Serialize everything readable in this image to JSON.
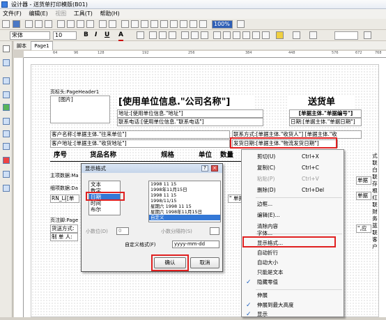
{
  "window": {
    "title": "设计器 - 送货单打印模版(B01)"
  },
  "menu": [
    "文件(F)",
    "编辑(E)",
    "视图",
    "工具(T)",
    "帮助(H)"
  ],
  "toolbar": {
    "zoom": "100%",
    "font_name": "宋体",
    "font_size": "10",
    "bold": "B",
    "italic": "I",
    "underline": "U",
    "font_color": "A"
  },
  "tabs": {
    "script": "脚本",
    "page": "Page1"
  },
  "ruler_marks": [
    "64",
    "96",
    "128",
    "192",
    "256",
    "384",
    "448",
    "576",
    "672",
    "768"
  ],
  "report": {
    "page_header_label": "页标头:PageHeader1",
    "picture": "[图片]",
    "company_title": "[使用单位信息.\"公司名称\"]",
    "doc_title": "送货单",
    "address": "地址:[使用单位信息.\"地址\"]",
    "doc_no": "[单据主体.\"单据编号\"]",
    "phone": "联系电话:[使用单位信息.\"联系电话\"]",
    "date": "日期:[单据主体.\"单据日期\"]",
    "customer": "客户名称:[单据主体.\"往来单位\"]",
    "contact": "联系方式:[单据主体.\"收货人\"] [单据主体.\"收",
    "cust_address": "客户地址:[单据主体.\"收货地址\"]",
    "ship_date": "发货日期:[单据主体.\"物流发货日期\"]",
    "col_no": "序号",
    "col_name": "货品名称",
    "col_spec": "规格",
    "col_unit": "单位",
    "col_qty": "数量",
    "main_band": "主项数据:Ma",
    "detail_band": "细项数据:Da",
    "detail_line": "RN_Lin",
    "detail_cell": "[单",
    "detail_cell2": "\" 单据",
    "footer_band": "页注脚:Page",
    "ship_method": "货送方式:",
    "maker": "制 单 人:",
    "right_cell1": "单据",
    "right_cell2": "单据",
    "right_cell3": "\",应",
    "side_labels": [
      "式",
      "联",
      "白",
      "联",
      "存",
      "根",
      "红",
      "联",
      "财",
      "务",
      "蓝",
      "联",
      "客",
      "户"
    ]
  },
  "context_menu": {
    "items": [
      {
        "label": "剪切(U)",
        "shortcut": "Ctrl+X",
        "disabled": false
      },
      {
        "label": "复制(C)",
        "shortcut": "Ctrl+C",
        "disabled": false
      },
      {
        "label": "粘贴(P)",
        "shortcut": "Ctrl+V",
        "disabled": true
      },
      {
        "label": "删除(D)",
        "shortcut": "Ctrl+Del",
        "disabled": false
      },
      {
        "label": "边框...",
        "shortcut": "",
        "disabled": false
      },
      {
        "label": "编辑(E)...",
        "shortcut": "",
        "disabled": false
      },
      {
        "label": "清除内容",
        "shortcut": "",
        "disabled": false
      },
      {
        "label": "字体...",
        "shortcut": "",
        "disabled": false
      },
      {
        "label": "显示格式...",
        "shortcut": "",
        "disabled": false
      },
      {
        "label": "自动折行",
        "shortcut": "",
        "disabled": false
      },
      {
        "label": "自动大小",
        "shortcut": "",
        "disabled": false
      },
      {
        "label": "只能是文本",
        "shortcut": "",
        "disabled": false
      },
      {
        "label": "隐藏零值",
        "shortcut": "",
        "disabled": false,
        "checked": true
      },
      {
        "label": "伸展",
        "shortcut": "",
        "disabled": false
      },
      {
        "label": "伸展到最大高度",
        "shortcut": "",
        "disabled": false,
        "checked": true
      },
      {
        "label": "显示",
        "shortcut": "",
        "disabled": false,
        "checked": true
      }
    ]
  },
  "format_dialog": {
    "title": "显示格式",
    "categories": [
      "文本",
      "数字",
      "日期",
      "时间",
      "布尔"
    ],
    "selected_category": "日期",
    "formats": [
      "1998 11 15",
      "1998年11月15日",
      "1998 11 15",
      "1998/11/15",
      "星期六 1998 11 15",
      "星期六 1998年11月15日",
      "自定义"
    ],
    "selected_format": "自定义",
    "decimals_label": "小数位(D)",
    "decimals_value": "0",
    "separator_label": "小数分隔符(S)",
    "custom_label": "自定义格式(F)",
    "custom_value": "yyyy-mm-dd",
    "ok": "确认",
    "cancel": "取消"
  },
  "colors": {
    "highlight": "#e02020",
    "selection": "#3478d6"
  }
}
